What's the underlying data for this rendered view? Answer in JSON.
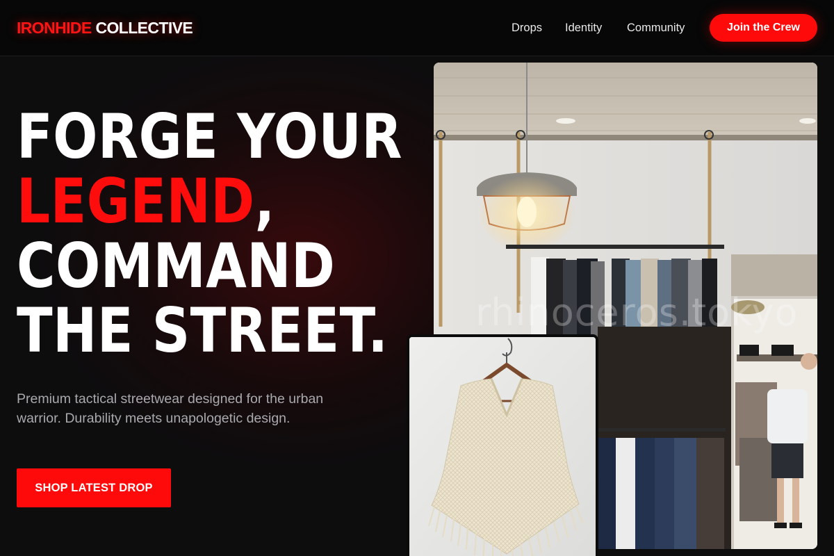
{
  "brand": {
    "name_part1": "IRONHIDE",
    "name_part2": "COLLECTIVE"
  },
  "nav": {
    "links": [
      {
        "label": "Drops"
      },
      {
        "label": "Identity"
      },
      {
        "label": "Community"
      }
    ],
    "cta_label": "Join the Crew"
  },
  "hero": {
    "line1": "FORGE YOUR",
    "line2_accent": "LEGEND",
    "line2_rest": ",",
    "line3": "COMMAND",
    "line4": "THE STREET.",
    "subtext": "Premium tactical streetwear designed for the urban warrior. Durability meets unapologetic design.",
    "button_label": "SHOP LATEST DROP"
  },
  "images": {
    "store_watermark": "rhinoceros.tokyo"
  },
  "colors": {
    "accent": "#ff0a0a",
    "background": "#0d0d0e",
    "nav_background": "#070707",
    "text": "#ffffff",
    "muted_text": "#a9a9ae"
  }
}
